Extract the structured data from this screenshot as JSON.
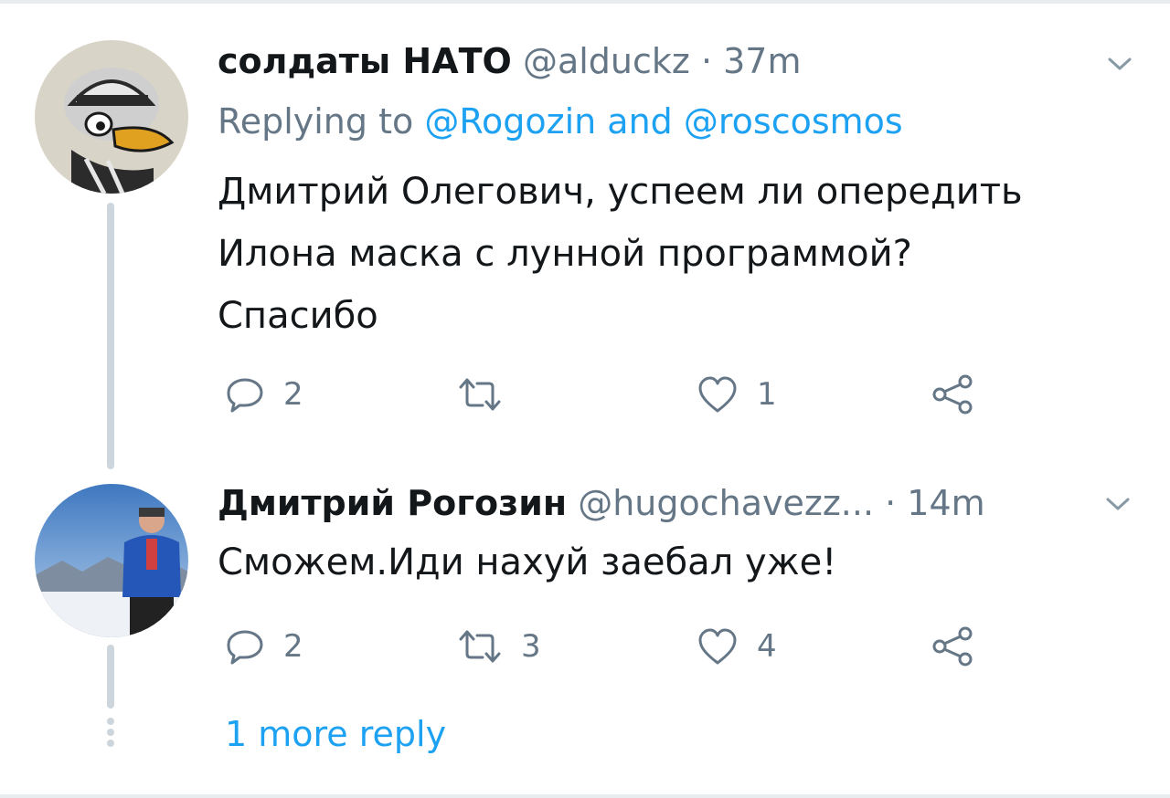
{
  "tweets": [
    {
      "display_name": "солдаты НАТО",
      "handle": "@alduckz",
      "separator": " · ",
      "time": "37m",
      "replying_prefix": "Replying to ",
      "replying_user1": "@Rogozin",
      "replying_and": " and ",
      "replying_user2": "@roscosmos",
      "text_lines": [
        "Дмитрий Олегович, успеем ли опередить",
        "Илона маска с лунной программой?",
        "Спасибо"
      ],
      "replies": "2",
      "retweets": "",
      "likes": "1"
    },
    {
      "display_name": "Дмитрий Рогозин",
      "handle": "@hugochavezz...",
      "separator": " · ",
      "time": "14m",
      "text": "Сможем.Иди нахуй заебал уже!",
      "replies": "2",
      "retweets": "3",
      "likes": "4"
    }
  ],
  "more_replies_label": "1 more reply",
  "icons": {
    "reply": "reply-icon",
    "retweet": "retweet-icon",
    "like": "heart-icon",
    "share": "share-icon",
    "caret": "chevron-down-icon"
  },
  "colors": {
    "link": "#1da1f2",
    "muted": "#657786",
    "text": "#14171a",
    "thread_line": "#cdd6dd"
  }
}
